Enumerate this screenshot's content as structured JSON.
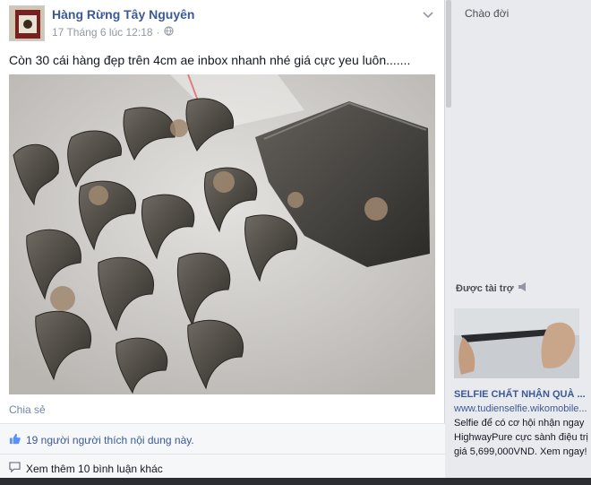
{
  "post": {
    "author": "Hàng Rừng Tây Nguyên",
    "timestamp": "17 Tháng 6 lúc 12:18",
    "privacy_icon": "globe-icon",
    "menu_icon": "chevron-down-icon",
    "status_text": "Còn 30 cái hàng đẹp trên 4cm ae inbox nhanh nhé giá cực yeu luôn.......",
    "share_label": "Chia sẻ",
    "likes_text": "19 người người thích nội dung này.",
    "comments_text": "Xem thêm 10 bình luận khác"
  },
  "sidebar": {
    "greeting": "Chào đời",
    "sponsored_label": "Được tài trợ",
    "ad": {
      "title": "SELFIE CHẤT NHẬN QUÀ ...",
      "url": "www.tudienselfie.wikomobile...",
      "text": "Selfie để có cơ hội nhận ngay HighwayPure cực sành điệu trị giá 5,699,000VND. Xem ngay!"
    }
  },
  "colors": {
    "link_blue": "#3b5998",
    "muted_gray": "#9197a3",
    "background": "#e9eaed"
  }
}
